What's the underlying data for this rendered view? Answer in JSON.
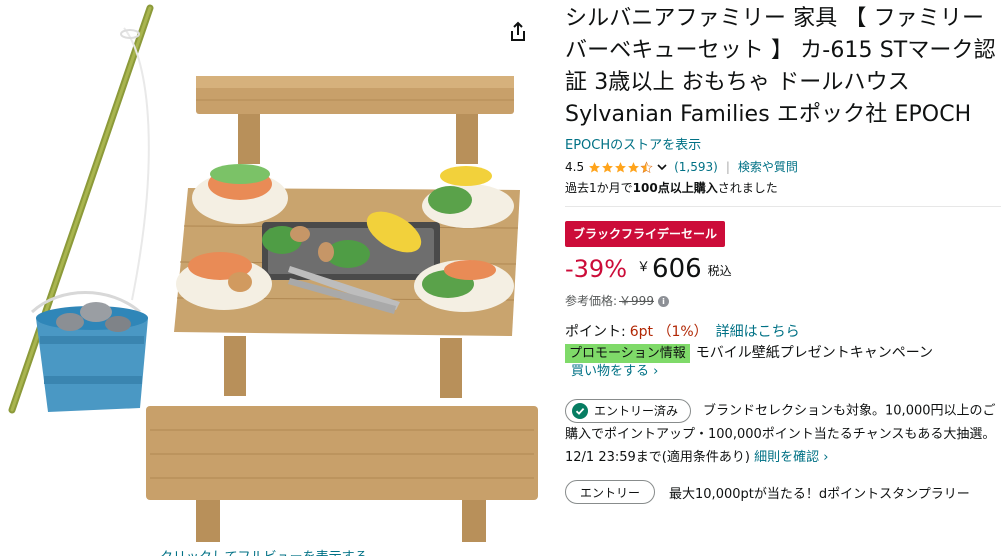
{
  "product": {
    "title": "シルバニアファミリー 家具 【 ファミリーバーベキューセット 】 カ-615 STマーク認証 3歳以上 おもちゃ ドールハウス Sylvanian Families エポック社 EPOCH",
    "store_link": "EPOCHのストアを表示",
    "rating": "4.5",
    "review_count": "(1,593)",
    "separator": "|",
    "qa_link": "検索や質問",
    "bought_prefix": "過去1か月で",
    "bought_bold": "100点以上購入",
    "bought_suffix": "されました"
  },
  "pricing": {
    "deal_badge": "ブラックフライデーセール",
    "discount": "-39%",
    "currency": "￥",
    "price": "606",
    "tax_label": "税込",
    "ref_label": "参考価格:",
    "ref_price": "￥999",
    "info_icon": "i"
  },
  "points": {
    "label": "ポイント:",
    "value": "6pt （1%）",
    "detail_link": "詳細はこちら"
  },
  "promotion": {
    "badge": "プロモーション情報",
    "text": "モバイル壁紙プレゼントキャンペーン",
    "shop_link": "買い物をする ›"
  },
  "entry": {
    "done_label": "エントリー済み",
    "text1": "ブランドセレクションも対象。10,000円以上のご購入でポイントアップ・100,000ポイント当たるチャンスもある大抽選。12/1 23:59まで(適用条件あり)",
    "detail_link": " 細則を確認 ›",
    "entry_button": "エントリー",
    "text2": "最大10,000ptが当たる！dポイントスタンプラリー"
  },
  "image": {
    "hint": "クリックしてフルビューを表示する"
  },
  "colors": {
    "link": "#007185",
    "deal_red": "#CC0C39",
    "promo_green": "#7FDA69",
    "star": "#FFA41C"
  },
  "icons": [
    "share-icon",
    "star-icon",
    "chevron-down-icon",
    "info-icon",
    "check-circle-icon"
  ]
}
